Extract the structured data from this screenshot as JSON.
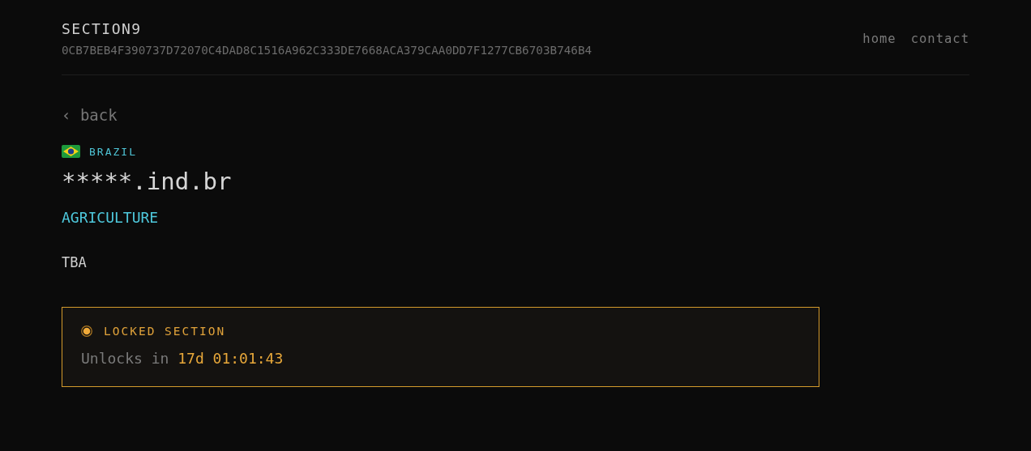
{
  "header": {
    "title": "SECTION9",
    "hash": "0CB7BEB4F390737D72070C4DAD8C1516A962C333DE7668ACA379CAA0DD7F1277CB6703B746B4",
    "nav": [
      "home",
      "contact"
    ]
  },
  "back_link": "‹ back",
  "country": "BRAZIL",
  "domain": "*****.ind.br",
  "sector": "AGRICULTURE",
  "description": "TBA",
  "lock_panel": {
    "title": "LOCKED SECTION",
    "label": "Unlocks in",
    "countdown": "17d 01:01:43"
  }
}
